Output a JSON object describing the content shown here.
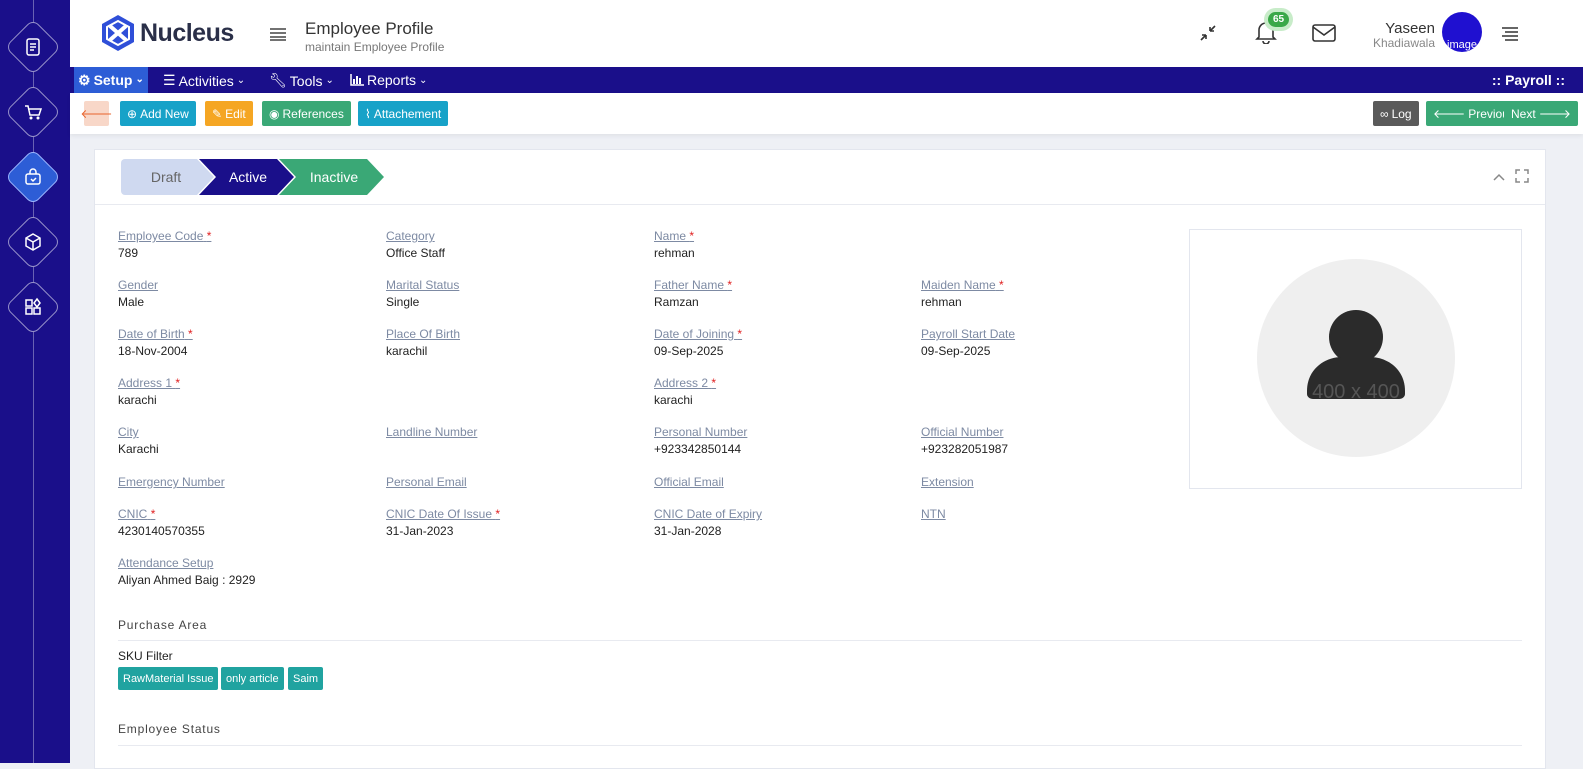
{
  "app": {
    "name": "Nucleus"
  },
  "page": {
    "title": "Employee Profile",
    "subtitle": "maintain Employee Profile"
  },
  "header": {
    "notif_count": "65",
    "user_first": "Yaseen",
    "user_last": "Khadiawala",
    "avatar_alt": "image"
  },
  "menu": {
    "setup": "Setup",
    "activities": "Activities",
    "tools": "Tools",
    "reports": "Reports",
    "module": ":: Payroll ::"
  },
  "toolbar": {
    "add_new": "Add New",
    "edit": "Edit",
    "references": "References",
    "attachment": "Attachement",
    "log": "Log",
    "previous": "Previous",
    "next": "Next"
  },
  "steps": {
    "draft": "Draft",
    "active": "Active",
    "inactive": "Inactive"
  },
  "fields": {
    "employee_code": {
      "label": "Employee Code",
      "value": "789"
    },
    "category": {
      "label": "Category",
      "value": "Office Staff"
    },
    "name": {
      "label": "Name",
      "value": "rehman"
    },
    "gender": {
      "label": "Gender",
      "value": "Male"
    },
    "marital_status": {
      "label": "Marital Status",
      "value": "Single"
    },
    "father_name": {
      "label": "Father Name",
      "value": "Ramzan"
    },
    "maiden_name": {
      "label": "Maiden Name",
      "value": "rehman"
    },
    "dob": {
      "label": "Date of Birth",
      "value": "18-Nov-2004"
    },
    "pob": {
      "label": "Place Of Birth",
      "value": "karachil"
    },
    "doj": {
      "label": "Date of Joining",
      "value": "09-Sep-2025"
    },
    "payroll_start": {
      "label": "Payroll Start Date",
      "value": "09-Sep-2025"
    },
    "address1": {
      "label": "Address 1",
      "value": "karachi"
    },
    "address2": {
      "label": "Address 2",
      "value": "karachi"
    },
    "city": {
      "label": "City",
      "value": "Karachi"
    },
    "landline": {
      "label": "Landline Number",
      "value": ""
    },
    "personal_number": {
      "label": "Personal Number",
      "value": "+923342850144"
    },
    "official_number": {
      "label": "Official Number",
      "value": "+923282051987"
    },
    "emergency_number": {
      "label": "Emergency Number",
      "value": ""
    },
    "personal_email": {
      "label": "Personal Email",
      "value": ""
    },
    "official_email": {
      "label": "Official Email",
      "value": ""
    },
    "extension": {
      "label": "Extension",
      "value": ""
    },
    "cnic": {
      "label": "CNIC",
      "value": "4230140570355"
    },
    "cnic_issue": {
      "label": "CNIC Date Of Issue",
      "value": "31-Jan-2023"
    },
    "cnic_expiry": {
      "label": "CNIC Date of Expiry",
      "value": "31-Jan-2028"
    },
    "ntn": {
      "label": "NTN",
      "value": ""
    },
    "attendance": {
      "label": "Attendance Setup",
      "value": "Aliyan Ahmed Baig : 2929"
    }
  },
  "photo": {
    "placeholder": "400 x 400"
  },
  "purchase": {
    "title": "Purchase Area",
    "sku_label": "SKU Filter",
    "tags": [
      "RawMaterial Issue",
      "only article",
      "Saim"
    ]
  },
  "status_section": {
    "title": "Employee Status"
  },
  "colors": {
    "brand": "#1a0f8a",
    "accent": "#2d5dd6",
    "teal": "#17a2b8",
    "green": "#3aa876",
    "orange": "#f5a623"
  }
}
